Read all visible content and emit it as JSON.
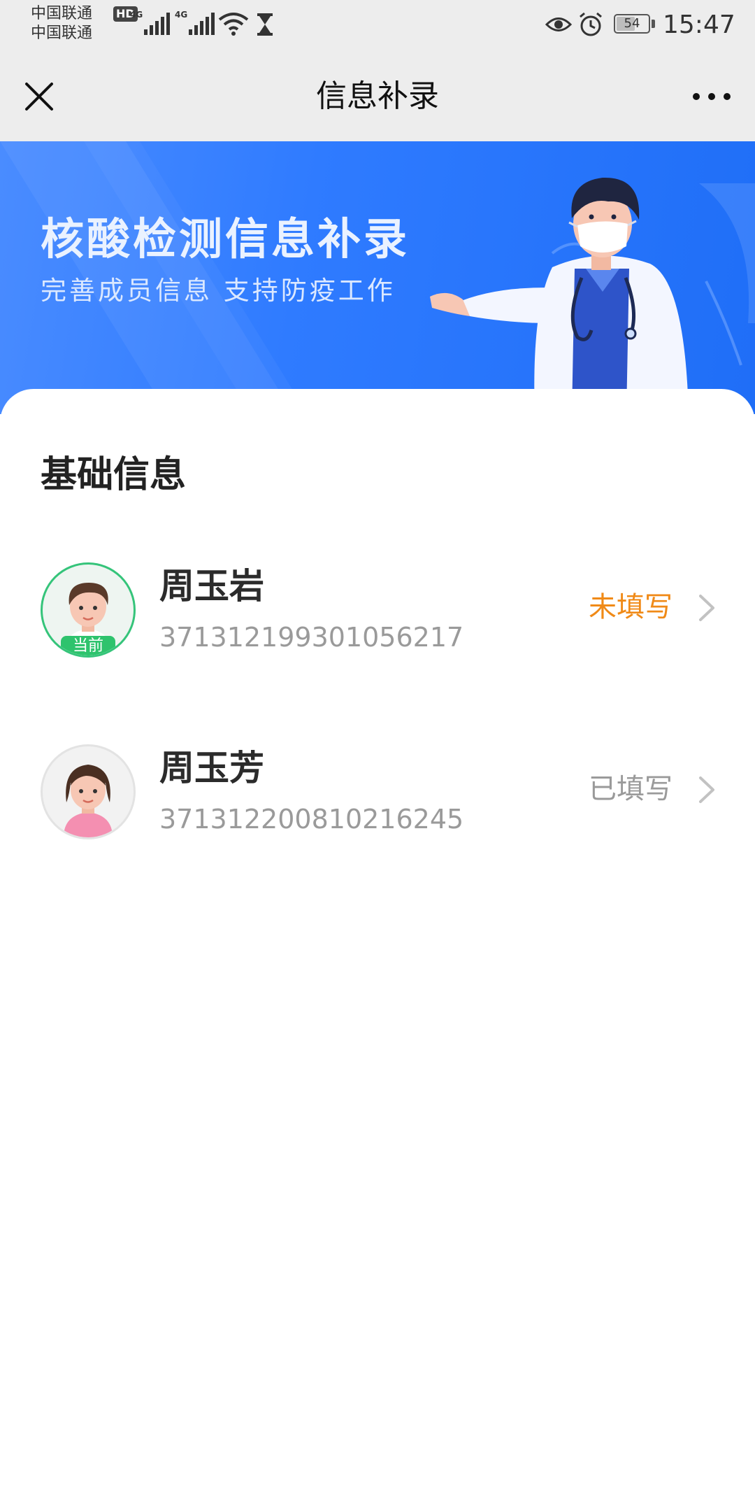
{
  "status_bar": {
    "carrier_1": "中国联通",
    "carrier_2": "中国联通",
    "hd_badge": "HD",
    "network_1": "4G",
    "network_2": "4G",
    "battery_level": "54",
    "time": "15:47"
  },
  "nav": {
    "title": "信息补录",
    "close_icon": "close-icon",
    "more_icon": "more-icon"
  },
  "banner": {
    "title": "核酸检测信息补录",
    "subtitle": "完善成员信息  支持防疫工作"
  },
  "section": {
    "title": "基础信息"
  },
  "members": [
    {
      "name": "周玉岩",
      "id_number": "371312199301056217",
      "status": "未填写",
      "tag": "当前",
      "avatar": "male-avatar"
    },
    {
      "name": "周玉芳",
      "id_number": "371312200810216245",
      "status": "已填写",
      "avatar": "female-avatar"
    }
  ],
  "colors": {
    "accent_blue": "#2f7bff",
    "pending_orange": "#f08a17",
    "current_green": "#2ec36d"
  }
}
